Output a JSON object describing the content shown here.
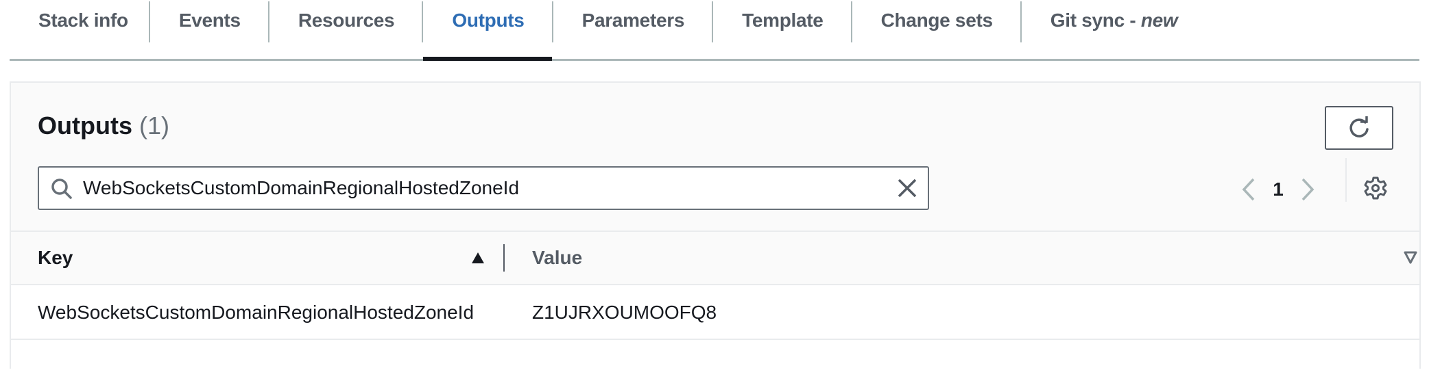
{
  "tabs": [
    {
      "label": "Stack info",
      "active": false
    },
    {
      "label": "Events",
      "active": false
    },
    {
      "label": "Resources",
      "active": false
    },
    {
      "label": "Outputs",
      "active": true
    },
    {
      "label": "Parameters",
      "active": false
    },
    {
      "label": "Template",
      "active": false
    },
    {
      "label": "Change sets",
      "active": false
    },
    {
      "label": "Git sync - ",
      "suffix": "new",
      "active": false
    }
  ],
  "panel": {
    "title": "Outputs",
    "count": "(1)",
    "refresh_icon": "refresh-icon",
    "search": {
      "value": "WebSocketsCustomDomainRegionalHostedZoneId",
      "placeholder": "",
      "icon": "search-icon",
      "clear_icon": "close-icon"
    },
    "pagination": {
      "current_page": "1",
      "prev_icon": "chevron-left-icon",
      "next_icon": "chevron-right-icon"
    },
    "settings_icon": "gear-icon"
  },
  "table": {
    "columns": [
      {
        "label": "Key",
        "sort": "ascending"
      },
      {
        "label": "Value",
        "sort": "none"
      }
    ],
    "rows": [
      {
        "key": "WebSocketsCustomDomainRegionalHostedZoneId",
        "value": "Z1UJRXOUMOOFQ8"
      }
    ]
  },
  "colors": {
    "active_tab": "#2e6db4",
    "tab_text": "#545b64",
    "text": "#16191f",
    "muted": "#687078",
    "border": "#aab7b8"
  }
}
